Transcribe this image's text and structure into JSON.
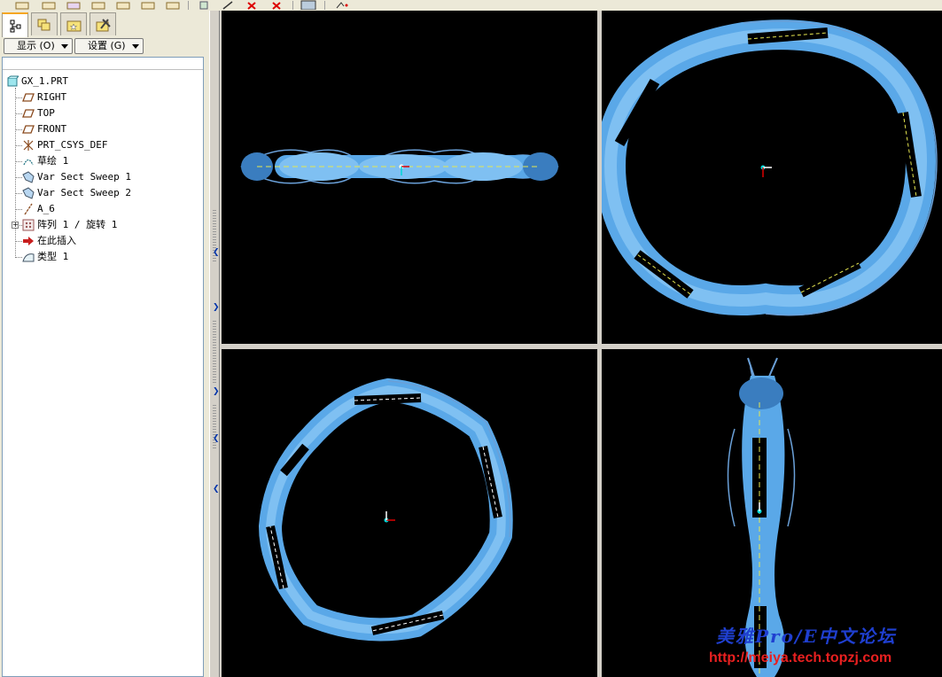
{
  "colors": {
    "model_blue": "#5aa8e8",
    "model_dark": "#2a6fb0",
    "viewport_bg": "#000000",
    "tab_accent": "#f5a623"
  },
  "left_panel": {
    "tabs": [
      {
        "name": "model-tree-tab",
        "icon": "model-tree-icon"
      },
      {
        "name": "layers-tab",
        "icon": "layers-icon"
      },
      {
        "name": "folder-browser-tab",
        "icon": "folder-icon"
      },
      {
        "name": "favorites-tab",
        "icon": "favorites-icon"
      }
    ],
    "show_menu": {
      "label": "显示 (O)"
    },
    "settings_menu": {
      "label": "设置 (G)"
    },
    "tree": {
      "root": "GX_1.PRT",
      "items": [
        {
          "label": "RIGHT",
          "icon": "datum-plane-icon"
        },
        {
          "label": "TOP",
          "icon": "datum-plane-icon"
        },
        {
          "label": "FRONT",
          "icon": "datum-plane-icon"
        },
        {
          "label": "PRT_CSYS_DEF",
          "icon": "coordinate-system-icon"
        },
        {
          "label": "草绘 1",
          "icon": "sketch-icon"
        },
        {
          "label": "Var Sect Sweep 1",
          "icon": "sweep-icon"
        },
        {
          "label": "Var Sect Sweep 2",
          "icon": "sweep-icon"
        },
        {
          "label": "A_6",
          "icon": "datum-axis-icon"
        },
        {
          "label": "阵列 1 / 旋转 1",
          "icon": "pattern-icon"
        },
        {
          "label": "在此插入",
          "icon": "insert-here-icon"
        },
        {
          "label": "类型 1",
          "icon": "surface-icon"
        }
      ]
    }
  },
  "watermark": {
    "title": "美雅Pro/E中文论坛",
    "url": "http://meiya.tech.topzj.com"
  }
}
